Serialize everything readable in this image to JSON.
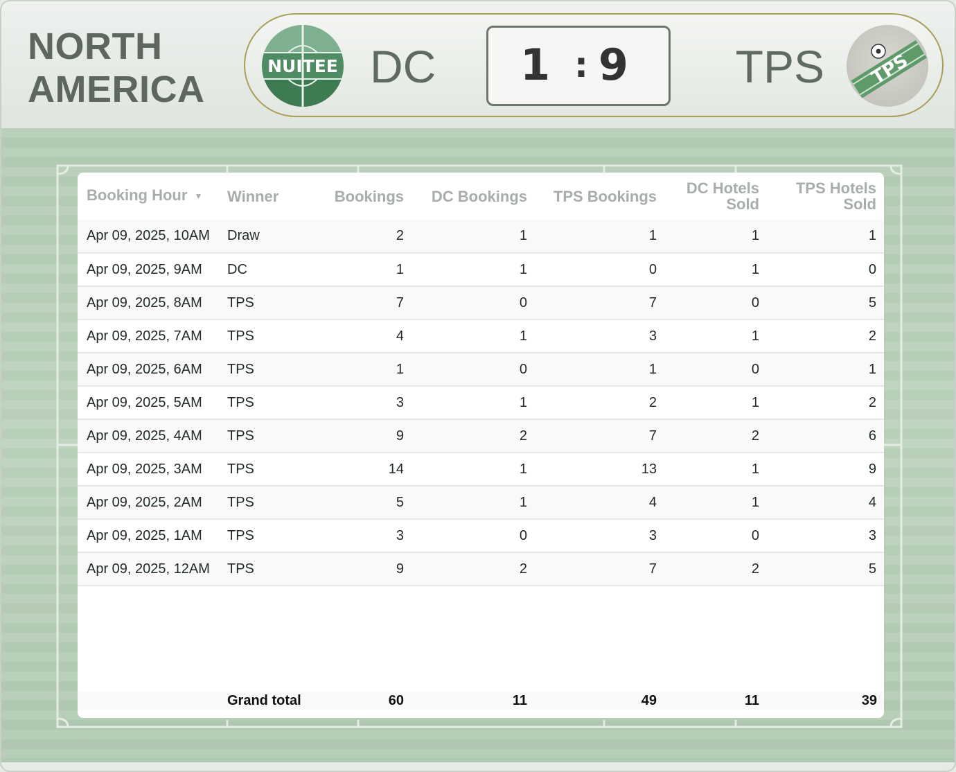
{
  "header": {
    "region_line1": "NORTH",
    "region_line2": "AMERICA"
  },
  "scoreboard": {
    "home_team": "DC",
    "away_team": "TPS",
    "home_score": "1",
    "separator": ":",
    "away_score": "9",
    "home_logo_text": "NUITEE",
    "away_logo_text": "TPS"
  },
  "table": {
    "columns": [
      "Booking Hour",
      "Winner",
      "Bookings",
      "DC Bookings",
      "TPS Bookings",
      "DC Hotels Sold",
      "TPS Hotels Sold"
    ],
    "sort_indicator": "▼",
    "rows": [
      [
        "Apr 09, 2025, 10AM",
        "Draw",
        "2",
        "1",
        "1",
        "1",
        "1"
      ],
      [
        "Apr 09, 2025, 9AM",
        "DC",
        "1",
        "1",
        "0",
        "1",
        "0"
      ],
      [
        "Apr 09, 2025, 8AM",
        "TPS",
        "7",
        "0",
        "7",
        "0",
        "5"
      ],
      [
        "Apr 09, 2025, 7AM",
        "TPS",
        "4",
        "1",
        "3",
        "1",
        "2"
      ],
      [
        "Apr 09, 2025, 6AM",
        "TPS",
        "1",
        "0",
        "1",
        "0",
        "1"
      ],
      [
        "Apr 09, 2025, 5AM",
        "TPS",
        "3",
        "1",
        "2",
        "1",
        "2"
      ],
      [
        "Apr 09, 2025, 4AM",
        "TPS",
        "9",
        "2",
        "7",
        "2",
        "6"
      ],
      [
        "Apr 09, 2025, 3AM",
        "TPS",
        "14",
        "1",
        "13",
        "1",
        "9"
      ],
      [
        "Apr 09, 2025, 2AM",
        "TPS",
        "5",
        "1",
        "4",
        "1",
        "4"
      ],
      [
        "Apr 09, 2025, 1AM",
        "TPS",
        "3",
        "0",
        "3",
        "0",
        "3"
      ],
      [
        "Apr 09, 2025, 12AM",
        "TPS",
        "9",
        "2",
        "7",
        "2",
        "5"
      ]
    ],
    "total": {
      "label": "Grand total",
      "values": [
        "60",
        "11",
        "49",
        "11",
        "39"
      ]
    }
  },
  "colors": {
    "pitch": "#b9cfb9",
    "scoreboard_border": "#a89f57",
    "title_text": "#5d6760",
    "header_text": "#a7adaa"
  }
}
